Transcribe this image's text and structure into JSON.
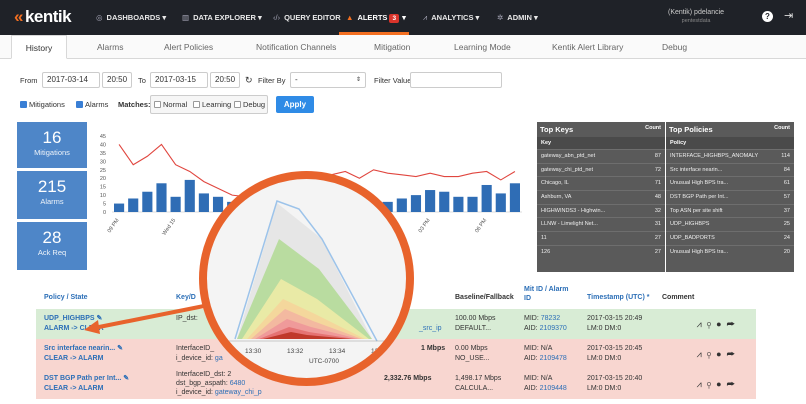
{
  "nav": {
    "logo": "kentik",
    "items": [
      {
        "icon": "dashboard-icon",
        "label": "DASHBOARDS ▾"
      },
      {
        "icon": "chart-icon",
        "label": "DATA EXPLORER ▾"
      },
      {
        "icon": "code-icon",
        "label": "QUERY EDITOR"
      },
      {
        "icon": "bell-icon",
        "label": "ALERTS",
        "badge": "3"
      },
      {
        "icon": "analytics-icon",
        "label": "ANALYTICS ▾"
      },
      {
        "icon": "gear-icon",
        "label": "ADMIN ▾"
      }
    ],
    "user": "(Kentik) pdelancie",
    "user_sub": "pentestdata"
  },
  "tabs": [
    "History",
    "Alarms",
    "Alert Policies",
    "Notification Channels",
    "Mitigation",
    "Learning Mode",
    "Kentik Alert Library",
    "Debug"
  ],
  "filters": {
    "from_label": "From",
    "from_date": "2017-03-14",
    "from_time": "20:50",
    "to_label": "To",
    "to_date": "2017-03-15",
    "to_time": "20:50",
    "filter_by_label": "Filter By",
    "filter_by_value": "-",
    "filter_value_label": "Filter Value",
    "mitigations": "Mitigations",
    "alarms": "Alarms",
    "matches_label": "Matches:",
    "normal": "Normal",
    "learning": "Learning",
    "debug": "Debug",
    "apply": "Apply"
  },
  "stats": [
    {
      "value": "16",
      "label": "Mitigations"
    },
    {
      "value": "215",
      "label": "Alarms"
    },
    {
      "value": "28",
      "label": "Ack Req"
    }
  ],
  "chart_data": {
    "type": "bar",
    "categories": [
      "09 PM",
      "",
      "",
      "",
      "Wed 15",
      "",
      "",
      "",
      "",
      "",
      "",
      "",
      "",
      "",
      "",
      "",
      "",
      "",
      "",
      "",
      "",
      "",
      "03 PM",
      "",
      "",
      "",
      "06 PM",
      "",
      ""
    ],
    "series": [
      {
        "values": [
          5,
          8,
          12,
          17,
          9,
          19,
          11,
          9,
          6,
          5,
          4,
          6,
          4,
          3,
          5,
          6,
          5,
          4,
          5,
          6,
          8,
          10,
          13,
          12,
          9,
          9,
          16,
          11,
          17
        ]
      },
      {
        "values": [
          40,
          28,
          33,
          40,
          28,
          24,
          18,
          14,
          10,
          9,
          9,
          11,
          13,
          16,
          21,
          22,
          24,
          20,
          25,
          23,
          22,
          21,
          23,
          21,
          21,
          23,
          24,
          19,
          24
        ]
      }
    ],
    "ylim": [
      0,
      45
    ],
    "yticks": [
      "45",
      "40",
      "35",
      "30",
      "25",
      "20",
      "15",
      "10",
      "5",
      "0"
    ],
    "bar_color": "#2f6db5",
    "line_color": "#e0463f"
  },
  "zoom_chart": {
    "ticks": [
      "13:30",
      "13:32",
      "13:34",
      "13:36"
    ],
    "tz": "UTC-0700"
  },
  "top_keys": {
    "title": "Top Keys",
    "head": [
      "Key",
      "Count"
    ],
    "rows": [
      [
        "gateway_abn_ptd_net",
        "87"
      ],
      [
        "gateway_chi_ptd_net",
        "72"
      ],
      [
        "Chicago, IL",
        "71"
      ],
      [
        "Ashburn, VA",
        "48"
      ],
      [
        "HIGHWINDS3 - Highwin...",
        "32"
      ],
      [
        "LLNW - Limelight Net...",
        "31"
      ],
      [
        "11",
        "27"
      ],
      [
        "126",
        "27"
      ]
    ]
  },
  "top_policies": {
    "title": "Top Policies",
    "head": [
      "Policy",
      "Count"
    ],
    "rows": [
      [
        "INTERFACE_HIGHBPS_ANOMALY",
        "114"
      ],
      [
        "Src interface nearin...",
        "84"
      ],
      [
        "Unusual High BPS tra...",
        "61"
      ],
      [
        "DST BGP Path per Int...",
        "57"
      ],
      [
        "Top ASN per site shift",
        "37"
      ],
      [
        "UDP_HIGHBPS",
        "25"
      ],
      [
        "UDP_BADPORTS",
        "24"
      ],
      [
        "Unusual High BPS tra...",
        "20"
      ]
    ]
  },
  "table": {
    "headers": {
      "policy": "Policy / State",
      "key": "Key/D",
      "baseline": "Baseline/Fallback",
      "mit_id": "Mit ID / Alarm",
      "mit_id2": "ID",
      "timestamp": "Timestamp (UTC) *",
      "comment": "Comment"
    },
    "rows": [
      {
        "policy": "UDP_HIGHBPS",
        "state": "ALARM -> CLEAR",
        "key1": "IP_dst: ",
        "key2": "",
        "key2b": "",
        "value": "",
        "src_ip": "_src_ip",
        "baseline1": "100.00 Mbps",
        "baseline2": "DEFAULT...",
        "mid": "MID: ",
        "mid_val": "78232",
        "aid": "AID: ",
        "aid_val": "2109370",
        "ts1": "2017-03-15 20:49",
        "ts2": "LM:0  DM:0"
      },
      {
        "policy": "Src interface nearin...",
        "state": "CLEAR -> ALARM",
        "key1": "InterfaceID_",
        "key2": "i_device_id: ",
        "key2b": "ga",
        "value": "1 Mbps",
        "src_ip": "",
        "baseline1": "0.00 Mbps",
        "baseline2": "NO_USE...",
        "mid": "MID: N/A",
        "mid_val": "",
        "aid": "AID: ",
        "aid_val": "2109478",
        "ts1": "2017-03-15 20:45",
        "ts2": "LM:0  DM:0"
      },
      {
        "policy": "DST BGP Path per Int...",
        "state": "CLEAR -> ALARM",
        "key1": "InterfaceID_dst: 2",
        "key2": "dst_bgp_aspath: ",
        "key2b": "6480",
        "key3": "i_device_id: ",
        "key3b": "gateway_chi_p",
        "value": "2,332.76 Mbps",
        "src_ip": "",
        "baseline1": "1,498.17 Mbps",
        "baseline2": "CALCULA...",
        "mid": "MID: N/A",
        "mid_val": "",
        "aid": "AID: ",
        "aid_val": "2109448",
        "ts1": "2017-03-15 20:40",
        "ts2": "LM:0  DM:0"
      }
    ],
    "actions": [
      "line-chart-icon",
      "search-icon",
      "binoculars-icon",
      "share-icon"
    ]
  }
}
